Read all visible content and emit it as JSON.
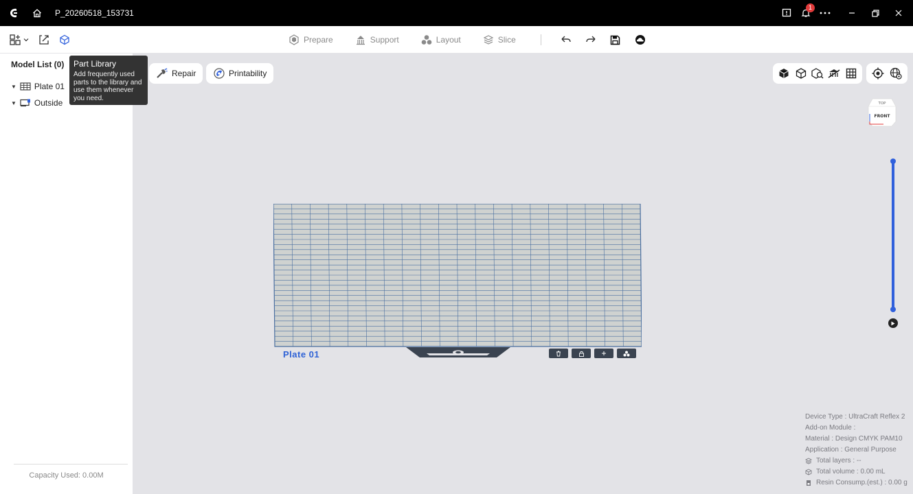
{
  "titlebar": {
    "title": "P_20260518_153731",
    "notification_count": "1",
    "icons": [
      "app-logo-icon",
      "home-icon",
      "feedback-icon",
      "bell-icon",
      "more-icon",
      "minimize-icon",
      "restore-icon",
      "close-icon"
    ]
  },
  "toolbar": {
    "steps": [
      {
        "label": "Prepare",
        "icon": "prepare-icon"
      },
      {
        "label": "Support",
        "icon": "support-icon"
      },
      {
        "label": "Layout",
        "icon": "layout-icon"
      },
      {
        "label": "Slice",
        "icon": "slice-icon"
      }
    ],
    "left_icons": [
      "add-model-icon",
      "import-icon",
      "part-library-icon"
    ],
    "actions": [
      "undo-icon",
      "redo-icon",
      "save-icon",
      "cloud-icon"
    ]
  },
  "sidebar": {
    "title": "Model List (0)",
    "items": [
      {
        "label": "Plate 01",
        "icon": "plate-grid-icon"
      },
      {
        "label": "Outside",
        "icon": "monitor-icon"
      }
    ],
    "capacity": "Capacity Used: 0.00M"
  },
  "tooltip": {
    "title": "Part Library",
    "body": "Add frequently used parts to the library and use them whenever you need."
  },
  "viewport": {
    "repair_label": "Repair",
    "printability_label": "Printability",
    "view_icons": [
      "solid-view-icon",
      "wireframe-view-icon",
      "xray-view-icon",
      "hide-support-icon",
      "grid-view-icon"
    ],
    "camera_icons": [
      "focus-icon",
      "view-cube-settings-icon"
    ],
    "cube": {
      "top": "TOP",
      "front": "FRONT"
    },
    "plate_label": "Plate 01",
    "plate_actions": [
      "delete-icon",
      "lock-icon",
      "add-icon",
      "arrange-icon"
    ]
  },
  "info": {
    "device_type": "Device Type : UltraCraft Reflex 2",
    "addon": "Add-on Module :",
    "material": "Material : Design CMYK PAM10",
    "application": "Application : General Purpose",
    "layers": "Total layers : --",
    "volume": "Total volume : 0.00 mL",
    "resin": "Resin Consump.(est.) : 0.00 g"
  },
  "colors": {
    "accent": "#3060dc",
    "plate_fill": "#cfd2d0",
    "plate_grid": "#4a6fa0",
    "viewport_bg": "#e3e3e7"
  }
}
